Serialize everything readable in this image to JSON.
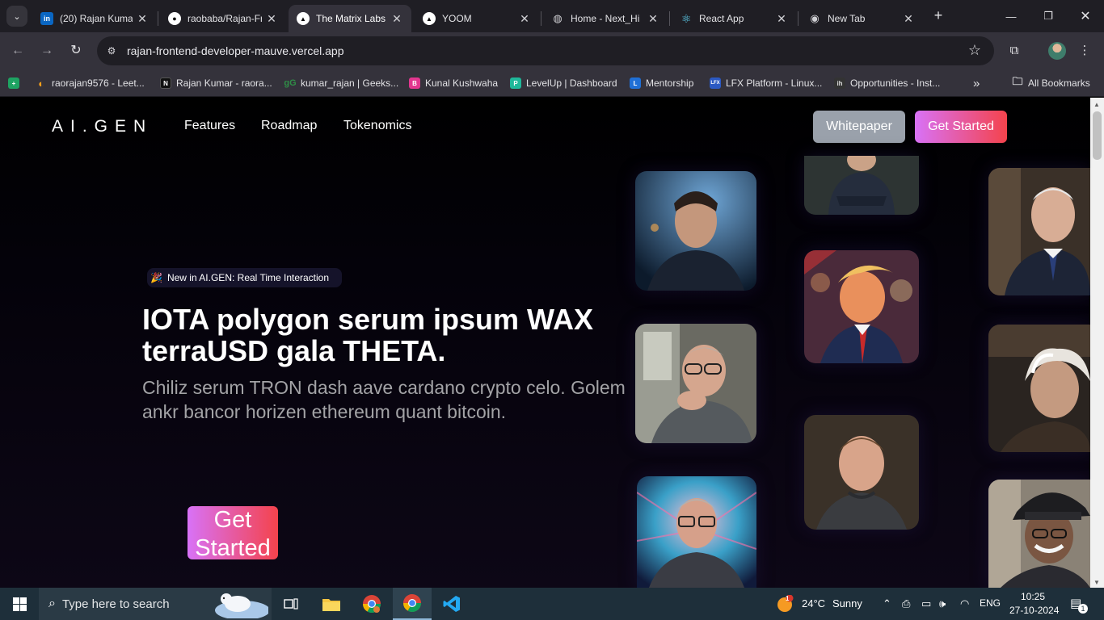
{
  "browser": {
    "tabs": [
      {
        "title": "(20) Rajan Kumar",
        "icon": "linkedin-icon",
        "active": false
      },
      {
        "title": "raobaba/Rajan-Fr",
        "icon": "github-icon",
        "active": false
      },
      {
        "title": "The Matrix Labs",
        "icon": "triangle-logo-icon",
        "active": true
      },
      {
        "title": "YOOM",
        "icon": "triangle-logo-icon",
        "active": false
      },
      {
        "title": "Home - Next_Hi",
        "icon": "globe-icon",
        "active": false
      },
      {
        "title": "React App",
        "icon": "react-icon",
        "active": false
      },
      {
        "title": "New Tab",
        "icon": "chrome-icon",
        "active": false
      }
    ],
    "url": "rajan-frontend-developer-mauve.vercel.app",
    "bookmarks": [
      {
        "label": "raorajan9576 - Leet...",
        "icon": "leetcode-icon"
      },
      {
        "label": "Rajan Kumar - raora...",
        "icon": "naukri-icon"
      },
      {
        "label": "kumar_rajan | Geeks...",
        "icon": "geeksforgeeks-icon"
      },
      {
        "label": "Kunal Kushwaha",
        "icon": "biolink-icon"
      },
      {
        "label": "LevelUp | Dashboard",
        "icon": "levelup-icon"
      },
      {
        "label": "Mentorship",
        "icon": "mentorship-icon"
      },
      {
        "label": "LFX Platform - Linux...",
        "icon": "lfx-icon"
      },
      {
        "label": "Opportunities - Inst...",
        "icon": "internshala-icon"
      }
    ],
    "all_bookmarks_label": "All Bookmarks"
  },
  "site": {
    "brand": "AI.GEN",
    "nav": [
      "Features",
      "Roadmap",
      "Tokenomics"
    ],
    "whitepaper_label": "Whitepaper",
    "get_started_label": "Get Started",
    "badge": "New in AI.GEN: Real Time Interaction",
    "hero_title": "IOTA polygon serum ipsum WAX terraUSD gala THETA.",
    "hero_subtitle": "Chiliz serum TRON dash aave cardano crypto celo. Golem ankr bancor horizen ethereum quant bitcoin.",
    "hero_cta": "Get Started",
    "accent_gradient": [
      "#d872f7",
      "#f4434c"
    ]
  },
  "taskbar": {
    "search_placeholder": "Type here to search",
    "weather": {
      "temp": "24°C",
      "condition": "Sunny",
      "alert_count": "1"
    },
    "language": "ENG",
    "time": "10:25",
    "date": "27-10-2024",
    "notification_count": "1"
  }
}
